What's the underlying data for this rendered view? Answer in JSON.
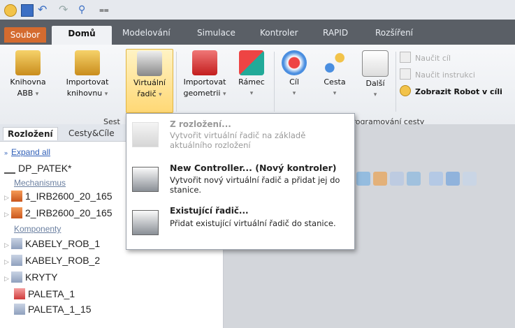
{
  "qat": {
    "icons": [
      "robot-studio-logo-icon",
      "save-icon",
      "undo-icon",
      "redo-icon",
      "zoom-icon",
      "customize-icon"
    ]
  },
  "tabs": {
    "file": "Soubor",
    "home": "Domů",
    "items": [
      "Modelování",
      "Simulace",
      "Kontroler",
      "RAPID",
      "Rozšíření"
    ]
  },
  "ribbon": {
    "buttons": [
      {
        "label": "Knihovna",
        "sub": "ABB"
      },
      {
        "label": "Importovat",
        "sub": "knihovnu"
      },
      {
        "label": "Virtuální",
        "sub": "řadič"
      },
      {
        "label": "Importovat",
        "sub": "geometrii"
      },
      {
        "label": "Rámec",
        "sub": ""
      },
      {
        "label": "Cíl",
        "sub": ""
      },
      {
        "label": "Cesta",
        "sub": ""
      },
      {
        "label": "Další",
        "sub": ""
      }
    ],
    "small": [
      "Naučit cíl",
      "Naučit instrukci",
      "Zobrazit Robot v cíli"
    ],
    "group_left": "Sest",
    "group_right": "Programování cesty"
  },
  "menu": {
    "items": [
      {
        "title": "Z rozložení...",
        "desc": "Vytvořit virtuální řadič na základě aktuálního rozložení",
        "disabled": true
      },
      {
        "title": "New Controller... (Nový kontroler)",
        "desc": "Vytvořit nový virtuální řadič a přidat jej do stanice.",
        "disabled": false
      },
      {
        "title": "Existující řadič...",
        "desc": "Přidat existující virtuální řadič do stanice.",
        "disabled": false
      }
    ]
  },
  "leftpanel": {
    "tab_active": "Rozložení",
    "tab_other": "Cesty&Cíle",
    "expand_all": "Expand all",
    "station": "DP_PATEK*",
    "cat_mech": "Mechanismus",
    "mech": [
      "1_IRB2600_20_165",
      "2_IRB2600_20_165"
    ],
    "cat_comp": "Komponenty",
    "comp": [
      "KABELY_ROB_1",
      "KABELY_ROB_2",
      "KRYTY",
      "PALETA_1",
      "PALETA_1_15"
    ]
  }
}
